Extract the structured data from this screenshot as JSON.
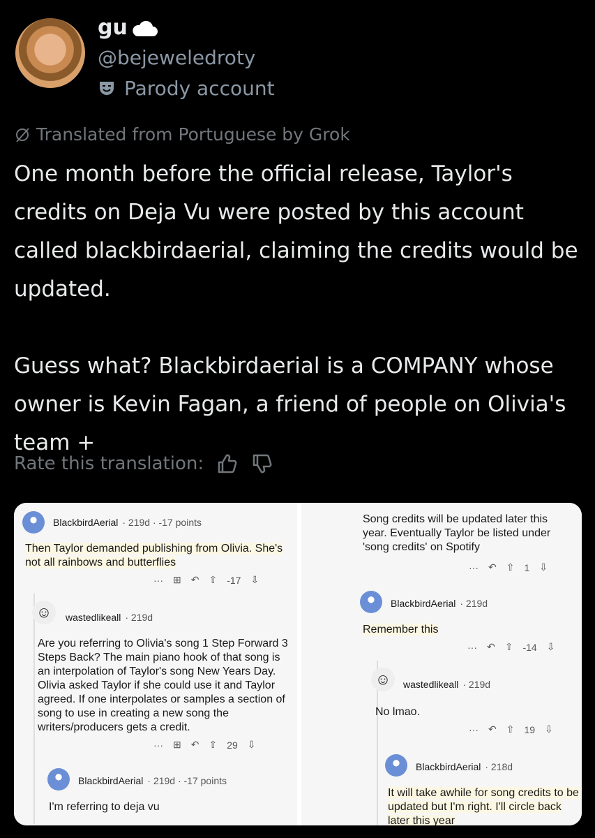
{
  "author": {
    "display_name": "gu",
    "handle": "@bejeweledroty",
    "badge": "Parody account",
    "avatar_icon": "profile-photo"
  },
  "translation": {
    "note": "Translated from Portuguese by Grok",
    "rate_label": "Rate this translation:"
  },
  "tweet": {
    "paragraph1": "One month before the official release, Taylor's credits on Deja Vu were posted by this account called blackbirdaerial, claiming the credits would be updated.",
    "paragraph2": "Guess what? Blackbirdaerial is a COMPANY whose owner is Kevin Fagan, a friend of people on Olivia's team +"
  },
  "screenshot_left": {
    "c1": {
      "user": "BlackbirdAerial",
      "meta": "· 219d · -17 points",
      "text": "Then Taylor demanded publishing from Olivia. She's not all rainbows and butterflies",
      "dots": "···",
      "score": "-17"
    },
    "c2": {
      "user": "wastedlikeall",
      "meta": "· 219d",
      "text": "Are you referring to Olivia's song 1 Step Forward 3 Steps Back? The main piano hook of that song is an interpolation of Taylor's song New Years Day. Olivia asked Taylor if she could use it and Taylor agreed. If one interpolates or samples a section of song to use in creating a new song the writers/producers gets a credit.",
      "dots": "···",
      "score": "29"
    },
    "c3": {
      "user": "BlackbirdAerial",
      "meta": "· 219d · -17 points",
      "text": "I'm referring to deja vu"
    }
  },
  "screenshot_right": {
    "c0": {
      "text": "Song credits will be updated later this year. Eventually Taylor be listed under 'song credits' on Spotify",
      "dots": "···",
      "score": "1"
    },
    "c1": {
      "user": "BlackbirdAerial",
      "meta": "· 219d",
      "text": "Remember this",
      "dots": "···",
      "score": "-14"
    },
    "c2": {
      "user": "wastedlikeall",
      "meta": "· 219d",
      "text": "No lmao.",
      "dots": "···",
      "score": "19"
    },
    "c3": {
      "user": "BlackbirdAerial",
      "meta": "· 218d",
      "text": "It will take awhile for song credits to be updated but I'm right. I'll circle back later this year"
    }
  },
  "colors": {
    "background": "#000000",
    "text": "#e7e9ea",
    "muted": "#71767b",
    "highlight": "#fcf7e2"
  }
}
